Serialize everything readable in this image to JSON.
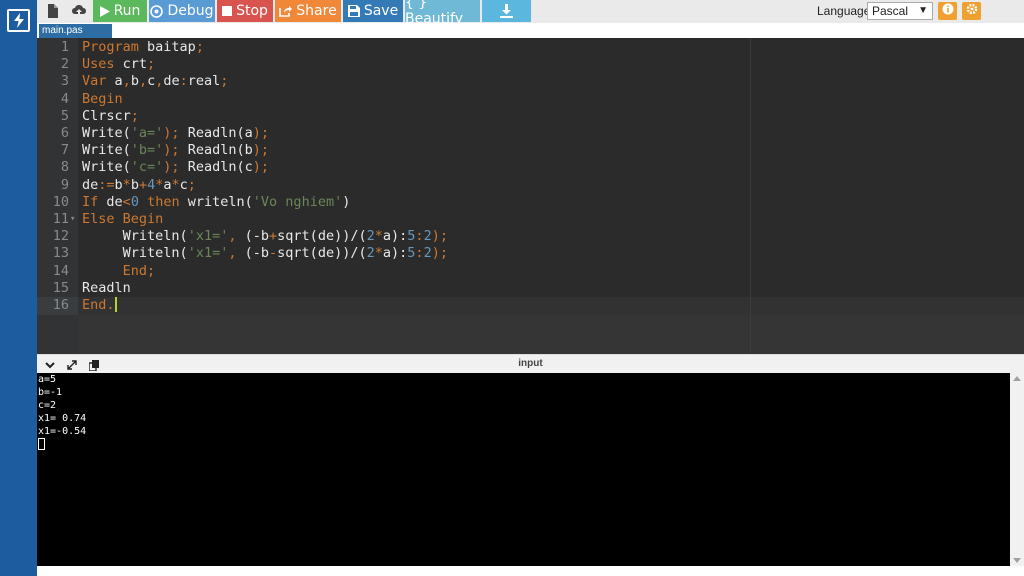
{
  "toolbar": {
    "run_label": "Run",
    "debug_label": "Debug",
    "stop_label": "Stop",
    "share_label": "Share",
    "save_label": "Save",
    "beautify_label": "{ } Beautify",
    "language_label": "Language",
    "language_value": "Pascal"
  },
  "file_tab": {
    "name": "main.pas"
  },
  "editor": {
    "line_numbers": [
      "1",
      "2",
      "3",
      "4",
      "5",
      "6",
      "7",
      "8",
      "9",
      "10",
      "11",
      "12",
      "13",
      "14",
      "15",
      "16"
    ],
    "lines": [
      "Program baitap;",
      "Uses crt;",
      "Var a,b,c,de:real;",
      "Begin",
      "Clrscr;",
      "Write('a='); Readln(a);",
      "Write('b='); Readln(b);",
      "Write('c='); Readln(c);",
      "de:=b*b+4*a*c;",
      "If de<0 then writeln('Vo nghiem')",
      "Else Begin",
      "     Writeln('x1=', (-b+sqrt(de))/(2*a):5:2);",
      "     Writeln('x1=', (-b-sqrt(de))/(2*a):5:2);",
      "     End;",
      "Readln",
      "End."
    ]
  },
  "console": {
    "title": "input",
    "output": [
      "a=5",
      "b=-1",
      "c=2",
      "x1= 0.74",
      "x1=-0.54"
    ]
  },
  "colors": {
    "run": "#5cb85c",
    "debug": "#5b9bd5",
    "stop": "#d9534f",
    "share": "#f0883a",
    "save": "#337ab7",
    "beautify": "#6fb9d6",
    "sidebar": "#1d5d9f",
    "keyword": "#cc7832",
    "string": "#6a8759",
    "number": "#6897bb"
  },
  "icons": [
    "lightning-icon",
    "new-file-icon",
    "upload-icon",
    "play-icon",
    "bug-icon",
    "stop-icon",
    "share-icon",
    "save-icon",
    "download-icon",
    "info-icon",
    "gear-icon",
    "chevron-down-icon",
    "expand-icon",
    "copy-icon"
  ]
}
